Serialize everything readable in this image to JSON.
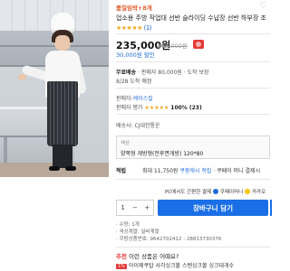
{
  "product": {
    "badge": "품질임박+8개",
    "title": "업소용 주방 작업대 선반 슬라이딩 수납장 선반 하부장 조",
    "rating_stars": "★★★★★",
    "rating_text": "(1)",
    "price": "235,000원",
    "price_original": "265,000원",
    "coupon": "30,000원 할인"
  },
  "delivery": {
    "label": "무료배송",
    "detail": "· 판매자 80,000원 · 도착 보장",
    "arrival": "8/28 도착 예정",
    "seller_label": "판매자:",
    "seller": "케이스킬",
    "seller_rating_label": "판매자 평가",
    "seller_rating_stars": "★★★★★",
    "seller_rating_pct": "100% (23)",
    "shipping_label": "배송사:",
    "shipping": "CJ대한통운"
  },
  "option": {
    "label": "색상",
    "value": "양쪽형 개방형(전후면개방) 120*80"
  },
  "points": {
    "label": "적립",
    "text_prefix": "최대 11,750원",
    "text_link": "쿠팡캐시 적립",
    "text_suffix": "· 쿠페이 머니 결제시"
  },
  "pay": {
    "label": "PC에서도 간편한 결제",
    "pay1": "쿠페이머니",
    "pay2": "카카오"
  },
  "cart": {
    "quantity": "1",
    "minus": "−",
    "plus": "+",
    "button": "장바구니 담기"
  },
  "info": {
    "line1": "· 수량: 1개",
    "line2": "· 색상계열: 실버계열",
    "line3": "· 쿠팡상품번호: 9642702412 - 28813730376"
  },
  "recommend": {
    "prefix": "추천",
    "title": "이런 상품은 어때요?",
    "item_pct": "1%",
    "item": "아이제쿠탑 사각싱크볼 스텐싱크볼 싱크대개수"
  }
}
